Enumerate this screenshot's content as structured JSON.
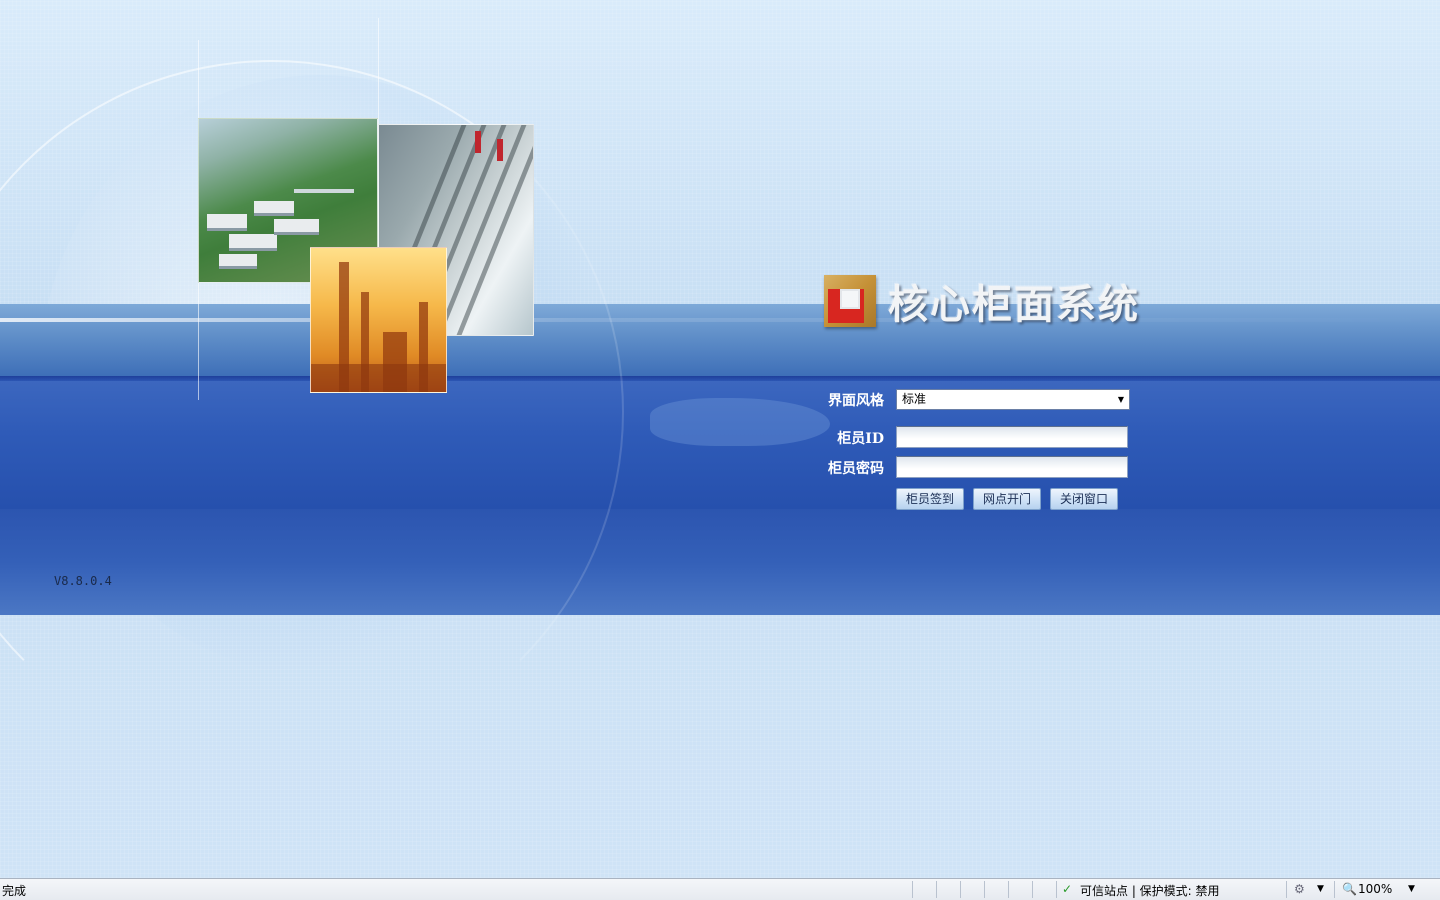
{
  "app": {
    "title": "核心柜面系统",
    "version": "V8.8.0.4"
  },
  "form": {
    "style_label": "界面风格",
    "style_value": "标准",
    "teller_id_label": "柜员ID",
    "teller_id_value": "",
    "password_label": "柜员密码",
    "password_value": ""
  },
  "buttons": {
    "sign_in": "柜员签到",
    "open_branch": "网点开门",
    "close_window": "关闭窗口"
  },
  "statusbar": {
    "status": "完成",
    "zone": "可信站点 | 保护模式: 禁用",
    "zoom": "100%"
  },
  "colors": {
    "band_blue": "#2f5bb8",
    "logo_red": "#d82620",
    "logo_gold": "#c59137"
  }
}
